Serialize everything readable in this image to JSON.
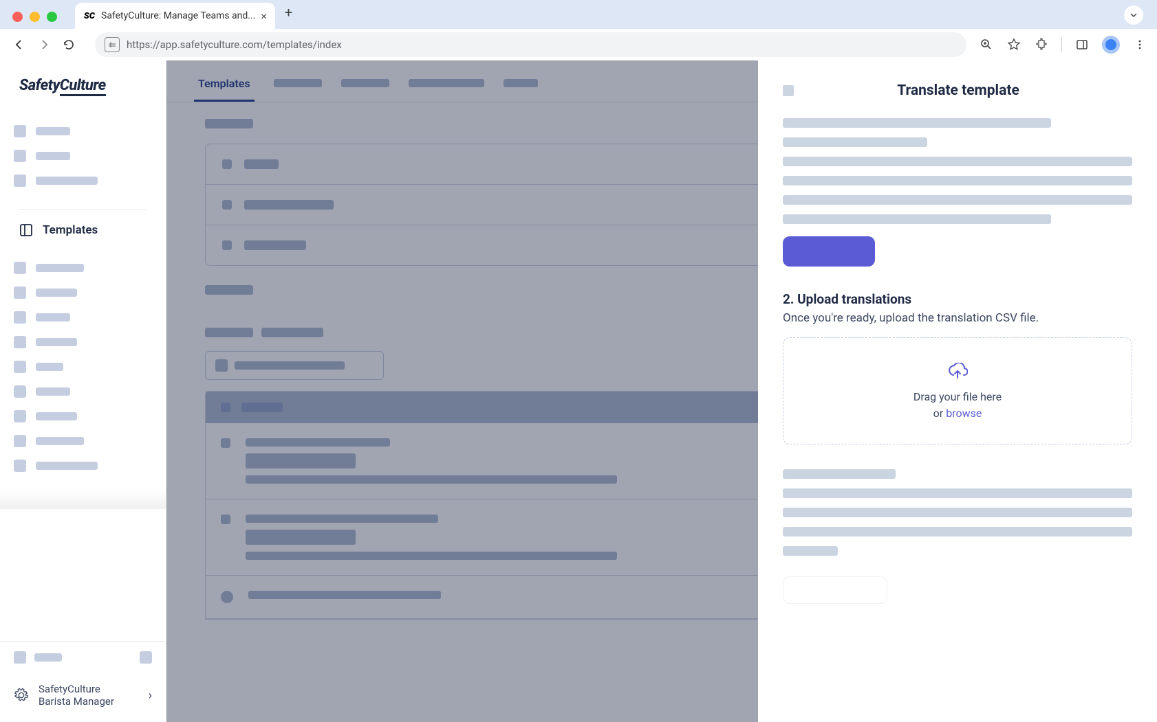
{
  "browser": {
    "tab_title": "SafetyCulture: Manage Teams and...",
    "url": "https://app.safetyculture.com/templates/index"
  },
  "app": {
    "logo_text": "SafetyCulture",
    "sidebar": {
      "templates_label": "Templates",
      "bottom_label_line1": "SafetyCulture",
      "bottom_label_line2": "Barista Manager"
    },
    "tabs": {
      "active": "Templates"
    }
  },
  "panel": {
    "title": "Translate template",
    "step2_title": "2. Upload translations",
    "step2_desc": "Once you're ready, upload the translation CSV file.",
    "dropzone_line1": "Drag your file here",
    "dropzone_or": "or ",
    "dropzone_browse": "browse"
  },
  "colors": {
    "primary": "#5b5bd6",
    "text_dark": "#1f2a44",
    "skeleton": "#c5cee0"
  }
}
